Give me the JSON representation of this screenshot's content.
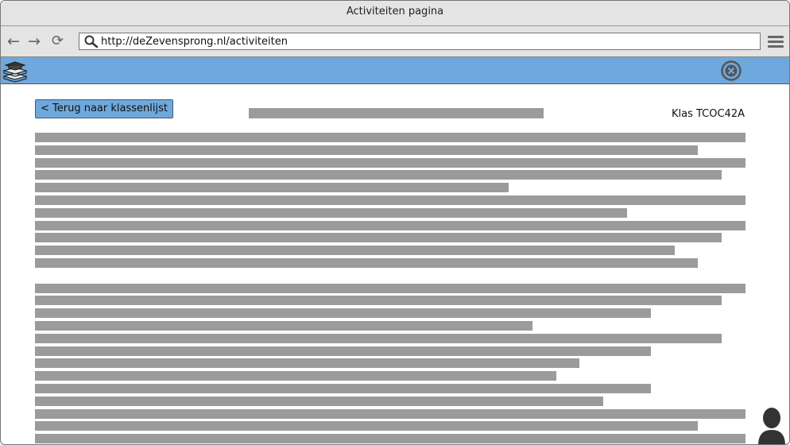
{
  "window": {
    "title": "Activiteiten pagina"
  },
  "browser": {
    "url": "http://deZevensprong.nl/activiteiten",
    "back_icon": "arrow-left-icon",
    "forward_icon": "arrow-right-icon",
    "reload_icon": "reload-icon",
    "menu_icon": "hamburger-menu-icon"
  },
  "appbar": {
    "logo_icon": "stacked-books-icon",
    "close_icon": "close-circle-icon",
    "color": "#6fa8dc"
  },
  "page": {
    "back_button_label": "< Terug naar klassenlijst",
    "class_label": "Klas TCOC42A"
  },
  "colors": {
    "placeholder_text": "#9b9b9b",
    "accent": "#6fa8dc"
  }
}
